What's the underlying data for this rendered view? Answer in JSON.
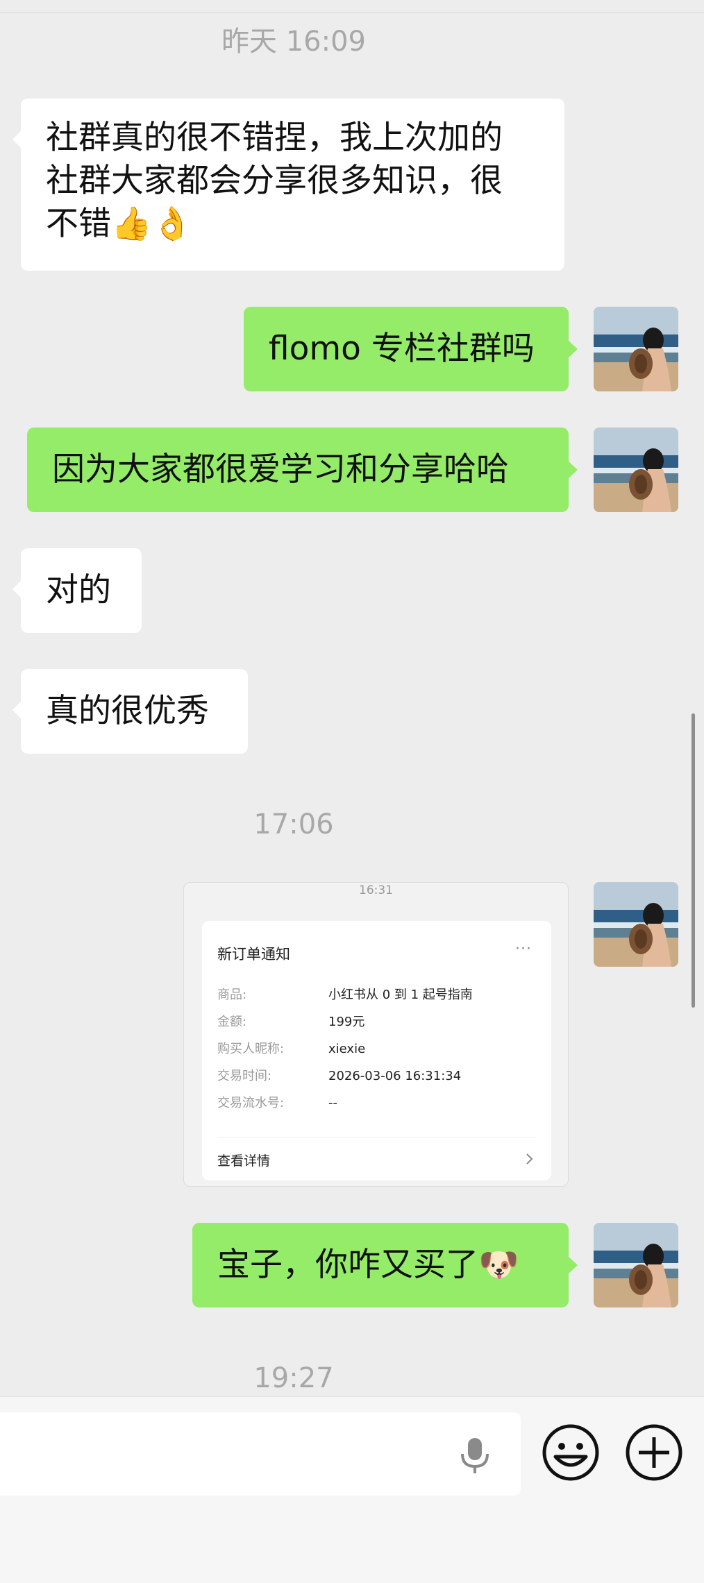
{
  "timestamps": {
    "t1": "昨天 16:09",
    "t2": "17:06",
    "t3": "19:27"
  },
  "messages": {
    "m1": {
      "line1": "社群真的很不错捏，我上次加的",
      "line2": "社群大家都会分享很多知识，很",
      "line3": "不错👍👌",
      "side": "left"
    },
    "m2": {
      "text": "flomo 专栏社群吗",
      "side": "right"
    },
    "m3": {
      "text": "因为大家都很爱学习和分享哈哈",
      "side": "right"
    },
    "m4": {
      "text": "对的",
      "side": "left"
    },
    "m5": {
      "text": "真的很优秀",
      "side": "left"
    },
    "m6": {
      "text": "宝子，你咋又买了",
      "emoji": "🐶",
      "side": "right"
    }
  },
  "order_card": {
    "time": "16:31",
    "title": "新订单通知",
    "more": "···",
    "rows": [
      {
        "key": "商品:",
        "value": "小红书从 0 到 1 起号指南"
      },
      {
        "key": "金额:",
        "value": "199元"
      },
      {
        "key": "购买人昵称:",
        "value": "xiexie"
      },
      {
        "key": "交易时间:",
        "value": "2026-03-06 16:31:34"
      },
      {
        "key": "交易流水号:",
        "value": "--"
      }
    ],
    "detail_label": "查看详情"
  },
  "icons": {
    "voice": "mic-icon",
    "emoji": "emoji-face-icon",
    "more": "plus-circle-icon"
  },
  "colors": {
    "background": "#ededed",
    "sent_bubble": "#95ec69",
    "received_bubble": "#ffffff",
    "timestamp": "#a8a8a8"
  }
}
